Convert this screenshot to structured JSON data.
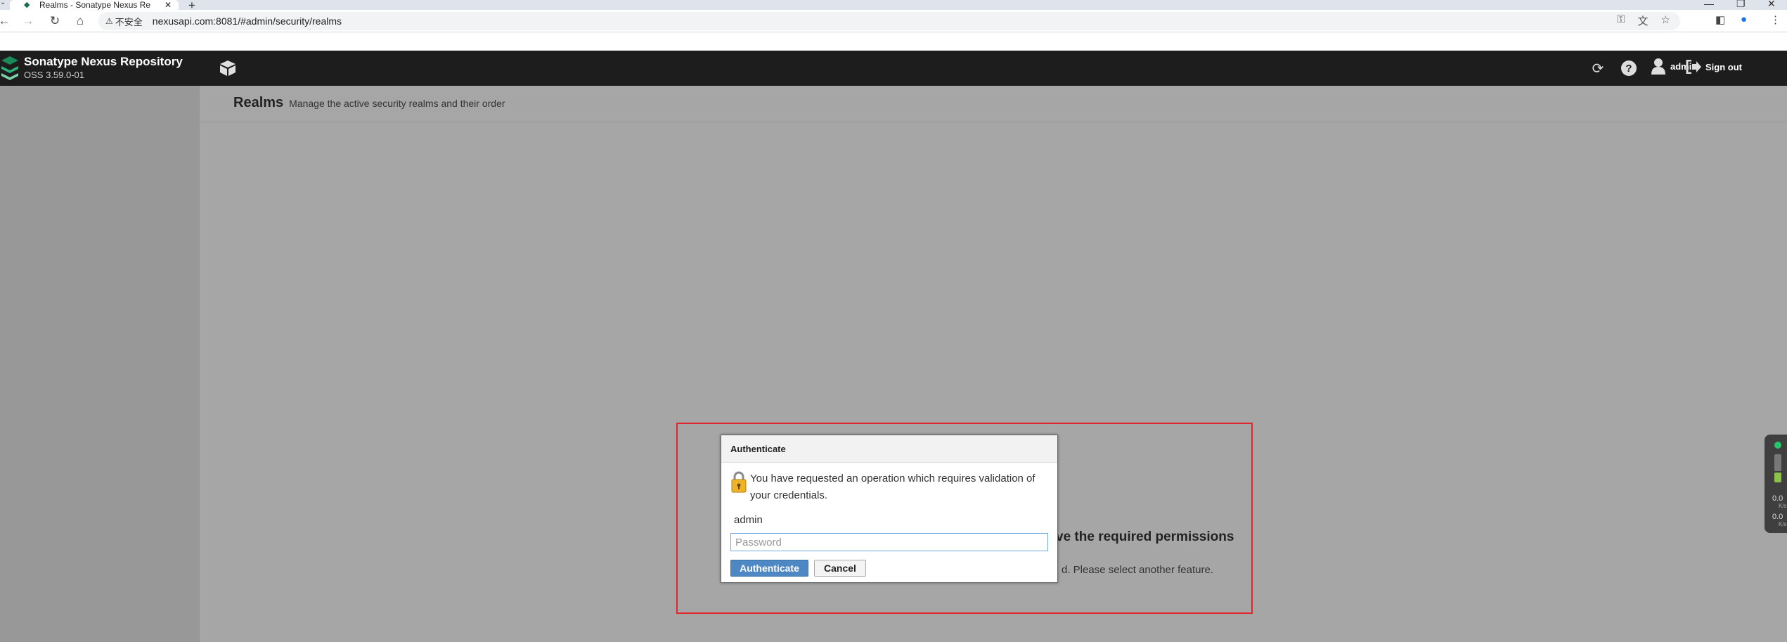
{
  "browser": {
    "tab_title": "Realms - Sonatype Nexus Re",
    "tab_close": "✕",
    "new_tab": "+",
    "security_label": "不安全",
    "url": "nexusapi.com:8081/#admin/security/realms"
  },
  "header": {
    "brand_title": "Sonatype Nexus Repository",
    "brand_version": "OSS 3.59.0-01",
    "user_label": "admin",
    "signout_label": "Sign out"
  },
  "page": {
    "title": "Realms",
    "subtitle": "Manage the active security realms and their order"
  },
  "background_message": {
    "heading": "ve the required permissions",
    "text": "d. Please select another feature."
  },
  "dialog": {
    "title": "Authenticate",
    "message": "You have requested an operation which requires validation of your credentials.",
    "username": "admin",
    "password_placeholder": "Password",
    "password_value": "",
    "authenticate_label": "Authenticate",
    "cancel_label": "Cancel"
  },
  "widget": {
    "value_1": "0.0",
    "unit_1": "K/s",
    "value_2": "0.0",
    "unit_2": "K/s",
    "colors": {
      "green": "#27c46a",
      "gray": "#777777",
      "lime": "#8bc34a"
    }
  },
  "colors": {
    "header_bg": "#1d1d1d",
    "sidebar_bg": "#989898",
    "content_bg": "#a6a6a6",
    "highlight_border": "#e0262b",
    "primary_button": "#4d88c5"
  },
  "icons": {
    "back": "back-arrow-icon",
    "forward": "forward-arrow-icon",
    "reload": "reload-icon",
    "home": "home-icon",
    "warning": "warning-triangle-icon",
    "key": "key-icon",
    "translate": "translate-icon",
    "star": "star-icon",
    "sidepanel": "side-panel-icon",
    "profile": "profile-icon",
    "menu": "kebab-menu-icon",
    "cube": "cube-icon",
    "refresh": "refresh-icon",
    "help": "help-icon",
    "user": "user-icon",
    "signout": "signout-icon",
    "lock": "lock-icon"
  }
}
